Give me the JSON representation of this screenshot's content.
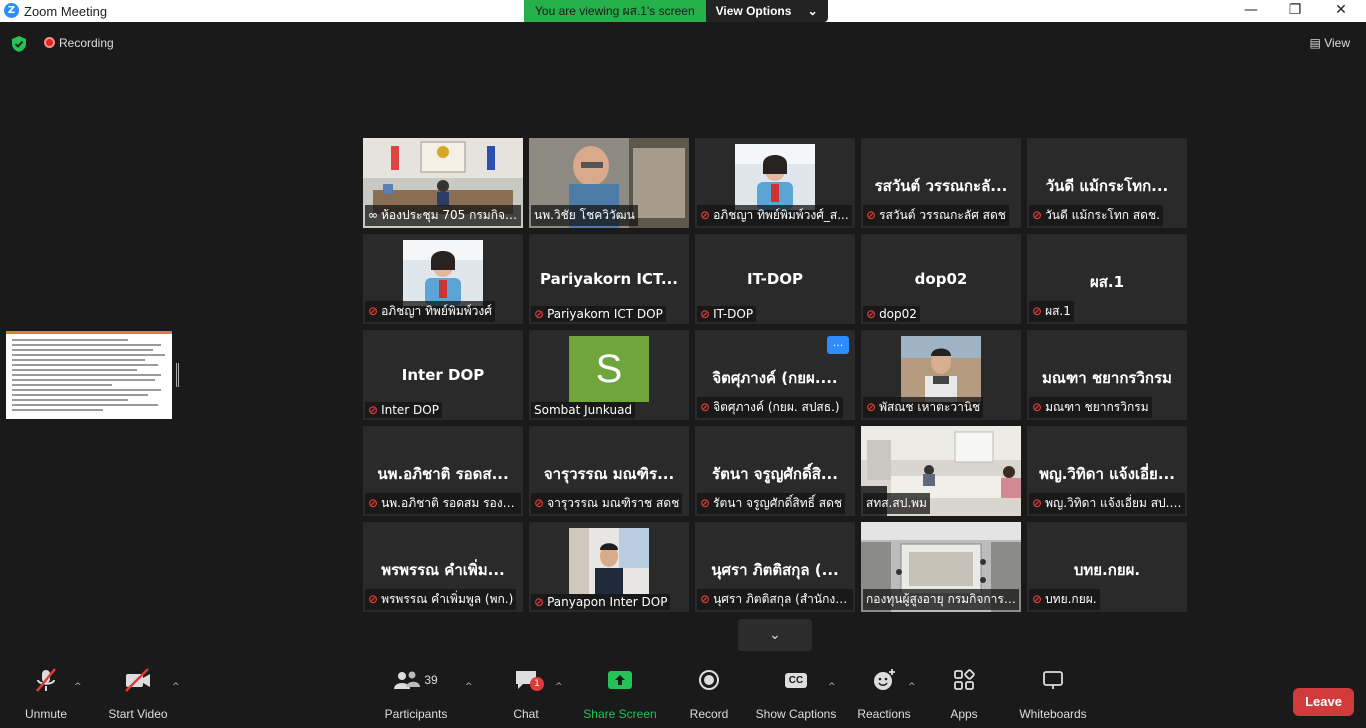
{
  "window": {
    "title": "Zoom Meeting",
    "logo_letter": "Z"
  },
  "banner": {
    "viewing_text": "You are viewing ผส.1's screen",
    "view_options_label": "View Options"
  },
  "topbar": {
    "recording_label": "Recording",
    "view_label": "View"
  },
  "tiles": [
    {
      "display": "photo-room",
      "label": "ห้องประชุม 705 กรมกิจก...",
      "mic_muted": false,
      "pinned": true
    },
    {
      "display": "photo-man",
      "label": "นพ.วิชัย โชควิวัฒน",
      "mic_muted": false,
      "active": true
    },
    {
      "display": "photo-woman",
      "label": "อภิชญา ทิพย์พิมพ์วงศ์_ส...",
      "mic_muted": true
    },
    {
      "display": "name",
      "big_name": "รสวันต์ วรรณกะลั...",
      "label": "รสวันต์ วรรณกะลัศ สดช",
      "mic_muted": true
    },
    {
      "display": "name",
      "big_name": "วันดี แม้กระโทก...",
      "label": "วันดี แม้กระโทก สดช.",
      "mic_muted": true
    },
    {
      "display": "photo-woman",
      "label": "อภิชญา ทิพย์พิมพ์วงศ์",
      "mic_muted": true
    },
    {
      "display": "name",
      "big_name": "Pariyakorn  ICT...",
      "label": "Pariyakorn ICT DOP",
      "mic_muted": true
    },
    {
      "display": "name",
      "big_name": "IT-DOP",
      "label": "IT-DOP",
      "mic_muted": true
    },
    {
      "display": "name",
      "big_name": "dop02",
      "label": "dop02",
      "mic_muted": true
    },
    {
      "display": "name",
      "big_name": "ผส.1",
      "label": "ผส.1",
      "mic_muted": true
    },
    {
      "display": "name",
      "big_name": "Inter DOP",
      "label": "Inter DOP",
      "mic_muted": true
    },
    {
      "display": "avatar",
      "avatar_letter": "S",
      "label": "Sombat Junkuad",
      "mic_muted": false
    },
    {
      "display": "name",
      "big_name": "จิตศุภางค์ (กยผ....",
      "label": "จิตศุภางค์ (กยผ. สปสธ.)",
      "mic_muted": true,
      "more_button": "..."
    },
    {
      "display": "photo-man2",
      "label": "พัสณช เหาตะวานิช",
      "mic_muted": true
    },
    {
      "display": "name",
      "big_name": "มณฑา ชยากรวิกรม",
      "label": "มณฑา ชยากรวิกรม",
      "mic_muted": true
    },
    {
      "display": "name",
      "big_name": "นพ.อภิชาติ รอดส...",
      "label": "นพ.อภิชาติ รอดสม รองเล...",
      "mic_muted": true
    },
    {
      "display": "name",
      "big_name": "จารุวรรณ มณฑิร...",
      "label": "จารุวรรณ มณฑิราช สดช",
      "mic_muted": true
    },
    {
      "display": "name",
      "big_name": "รัตนา จรูญศักดิ์สิ...",
      "label": "รัตนา จรูญศักดิ์สิทธิ์ สดช",
      "mic_muted": true
    },
    {
      "display": "photo-office",
      "label": "สทส.สป.พม",
      "mic_muted": false
    },
    {
      "display": "name",
      "big_name": "พญ.วิทิดา แจ้งเอี่ย...",
      "label": "พญ.วิทิดา แจ้งเอี่ยม สป.ก...",
      "mic_muted": true
    },
    {
      "display": "name",
      "big_name": "พรพรรณ คำเพิ่ม...",
      "label": "พรพรรณ คำเพิ่มพูล (พก.)",
      "mic_muted": true
    },
    {
      "display": "photo-man3",
      "label": "Panyapon Inter DOP",
      "mic_muted": true
    },
    {
      "display": "name",
      "big_name": "นุศรา  ภิตติสกุล (...",
      "label": "นุศรา  ภิตติสกุล (สำนักงา...",
      "mic_muted": true
    },
    {
      "display": "photo-meeting",
      "label": "กองทุนผู้สูงอายุ กรมกิจการผู้...",
      "mic_muted": false
    },
    {
      "display": "name",
      "big_name": "บทย.กยผ.",
      "label": "บทย.กยผ.",
      "mic_muted": true
    }
  ],
  "toolbar": {
    "unmute_label": "Unmute",
    "start_video_label": "Start Video",
    "participants_label": "Participants",
    "participants_count": "39",
    "chat_label": "Chat",
    "chat_badge": "1",
    "share_label": "Share Screen",
    "record_label": "Record",
    "captions_label": "Show Captions",
    "captions_icon_text": "CC",
    "reactions_label": "Reactions",
    "apps_label": "Apps",
    "whiteboards_label": "Whiteboards",
    "leave_label": "Leave"
  },
  "colors": {
    "accent": "#2d8cff",
    "share_green": "#26b04b",
    "leave_red": "#d13b3b",
    "active_border": "#d7e06a",
    "muted_red": "#e23a3a"
  }
}
